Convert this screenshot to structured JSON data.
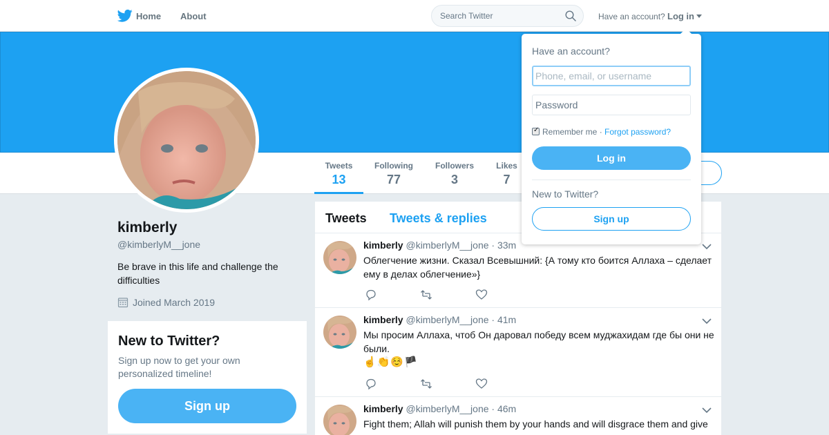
{
  "nav": {
    "home_label": "Home",
    "about_label": "About",
    "search_placeholder": "Search Twitter",
    "have_account": "Have an account?",
    "login_label": "Log in",
    "brand_color": "#1da1f2"
  },
  "profile": {
    "name": "kimberly",
    "handle": "@kimberlyM__jone",
    "bio": "Be brave in this life and challenge the difficulties",
    "joined": "Joined March 2019",
    "stats": [
      {
        "label": "Tweets",
        "value": "13"
      },
      {
        "label": "Following",
        "value": "77"
      },
      {
        "label": "Followers",
        "value": "3"
      },
      {
        "label": "Likes",
        "value": "7"
      }
    ]
  },
  "new_to_twitter": {
    "title": "New to Twitter?",
    "description": "Sign up now to get your own personalized timeline!",
    "signup_label": "Sign up"
  },
  "timeline": {
    "tabs": [
      "Tweets",
      "Tweets & replies"
    ],
    "tweets": [
      {
        "name": "kimberly",
        "handle": "@kimberlyM__jone",
        "time": "· 33m",
        "text": "Облегчение жизни. Сказал Всевышний: {А тому кто боится Аллаха – сделает ему в делах облегчение»}"
      },
      {
        "name": "kimberly",
        "handle": "@kimberlyM__jone",
        "time": "· 41m",
        "text": "Мы просим Аллаха, чтоб Он даровал победу всем муджахидам где бы они не были.",
        "emoji": "☝️👏☺️🏴"
      },
      {
        "name": "kimberly",
        "handle": "@kimberlyM__jone",
        "time": "· 46m",
        "text": "Fight them; Allah will punish them by your hands and will disgrace them and give"
      }
    ]
  },
  "login_dropdown": {
    "title": "Have an account?",
    "username_placeholder": "Phone, email, or username",
    "password_placeholder": "Password",
    "remember_me": "Remember me",
    "separator": "·",
    "forgot_password": "Forgot password?",
    "login_button": "Log in",
    "new_to_twitter": "New to Twitter?",
    "signup_button": "Sign up"
  }
}
